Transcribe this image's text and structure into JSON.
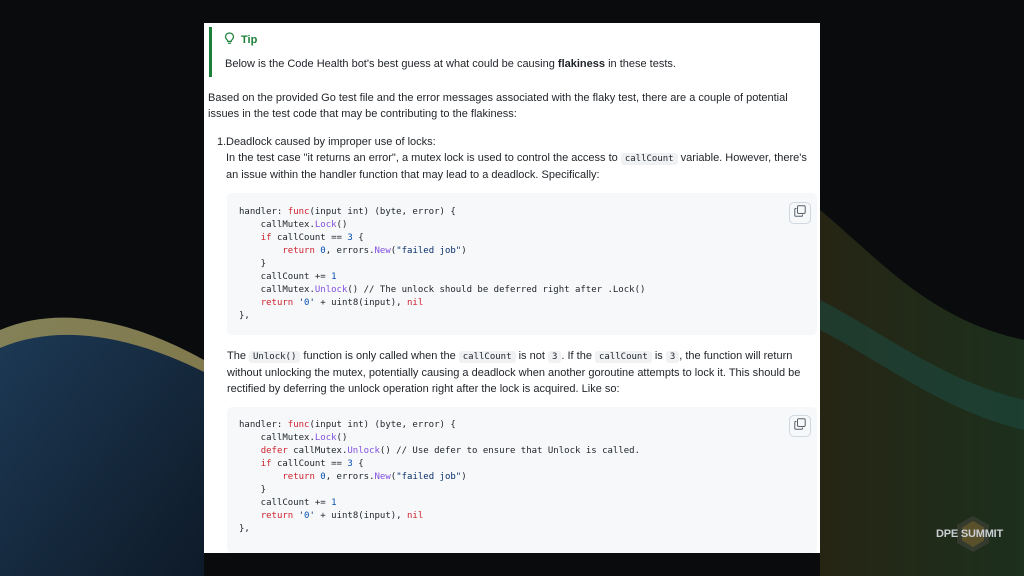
{
  "tip": {
    "label": "Tip",
    "text_before": "Below is the Code Health bot's best guess at what could be causing ",
    "text_bold": "flakiness",
    "text_after": " in these tests."
  },
  "intro": {
    "line1": "Based on the provided Go test file and the error messages associated with the flaky test, there are a couple of potential",
    "line2": "issues in the test code that may be contributing to the flakiness:"
  },
  "item1": {
    "number": "1.",
    "title": "Deadlock caused by improper use of locks:",
    "desc_a": "In the test case \"it returns an error\", a mutex lock is used to control the access to ",
    "desc_code": "callCount",
    "desc_b": " variable. However, there's",
    "desc_line2": "an issue within the handler function that may lead to a deadlock. Specifically:"
  },
  "code1": [
    "handler: func(input int) (byte, error) {",
    "    callMutex.Lock()",
    "    if callCount == 3 {",
    "        return 0, errors.New(\"failed job\")",
    "    }",
    "    callCount += 1",
    "    callMutex.Unlock() // The unlock should be deferred right after .Lock()",
    "    return '0' + uint8(input), nil",
    "},"
  ],
  "explain": {
    "t1": "The ",
    "c1": "Unlock()",
    "t2": " function is only called when the ",
    "c2": "callCount",
    "t3": " is not ",
    "c3": "3",
    "t4": ". If the ",
    "c4": "callCount",
    "t5": " is ",
    "c5": "3",
    "t6": ", the function will return",
    "line2": "without unlocking the mutex, potentially causing a deadlock when another goroutine attempts to lock it. This should be",
    "line3": "rectified by deferring the unlock operation right after the lock is acquired. Like so:"
  },
  "code2": [
    "handler: func(input int) (byte, error) {",
    "    callMutex.Lock()",
    "    defer callMutex.Unlock() // Use defer to ensure that Unlock is called.",
    "    if callCount == 3 {",
    "        return 0, errors.New(\"failed job\")",
    "    }",
    "    callCount += 1",
    "    return '0' + uint8(input), nil",
    "},"
  ],
  "brand": {
    "name": "DPE SUMMIT"
  },
  "icons": {
    "tip": "lightbulb-icon",
    "copy": "copy-icon"
  },
  "colors": {
    "tip_accent": "#1a7f37",
    "keyword": "#cf222e",
    "function": "#8250df",
    "string": "#0a3069",
    "number": "#0550ae"
  }
}
